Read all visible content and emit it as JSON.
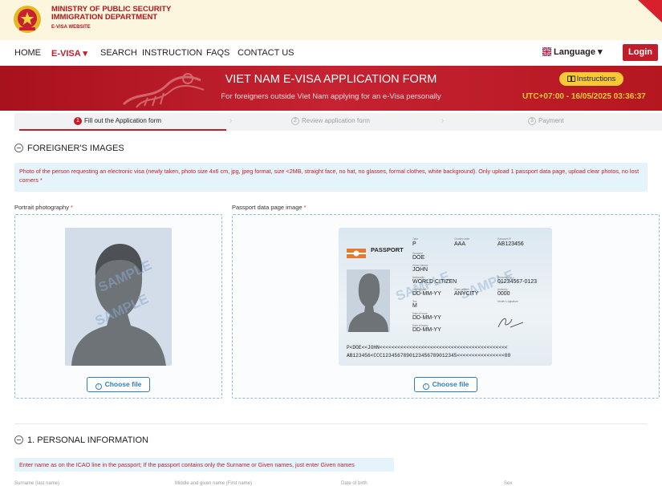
{
  "header": {
    "ministry_line1": "MINISTRY OF PUBLIC SECURITY",
    "ministry_line2": "IMMIGRATION DEPARTMENT",
    "ministry_line3": "E-VISA WEBSITE",
    "emblem_icon": "national-emblem-icon"
  },
  "nav": {
    "home": "HOME",
    "evisa": "E-VISA ▾",
    "search": "SEARCH",
    "instruction": "INSTRUCTION",
    "faqs": "FAQS",
    "contact": "CONTACT US",
    "language": "Language ▾",
    "login": "Login"
  },
  "banner": {
    "title": "VIET NAM E-VISA APPLICATION FORM",
    "subtitle": "For foreigners outside Viet Nam applying for an e-Visa personally",
    "instructions": "Instructions",
    "clock": "UTC+07:00 - 16/05/2025 03:36:37"
  },
  "steps": [
    {
      "num": "1",
      "label": "Fill out the Application form"
    },
    {
      "num": "2",
      "label": "Review application form"
    },
    {
      "num": "3",
      "label": "Payment"
    }
  ],
  "images_section": {
    "title": "FOREIGNER'S IMAGES",
    "info": "Photo of the person requesting an electronic visa (newly taken, photo size 4x6 cm, jpg, jpeg format, size <2MB, straight face, no hat, no glasses, formal clothes, white background). Only upload 1 passport data page, upload clear photos, no lost corners",
    "portrait_label": "Portrait photography",
    "passport_label": "Passport data page image",
    "choose_file": "Choose file",
    "sample_watermark": "SAMPLE"
  },
  "passport_sample": {
    "passport_word": "PASSPORT",
    "type_label": "Type",
    "type_value": "P",
    "country_label": "Country code",
    "country_value": "AAA",
    "number_label": "Passport Nº",
    "number_value": "AB123456",
    "surname_label": "Surname",
    "surname_value": "DOE",
    "given_label": "Given Names",
    "given_value": "JOHN",
    "nationality_label": "Nationality",
    "nationality_value": "WORLD CITIZEN",
    "dob_label": "Date of birth",
    "dob_value": "DD-MM-YY",
    "pob_label": "Place of birth",
    "pob_value": "ANYCITY",
    "personal_label": "Personal No.",
    "personal_value": "01234567-0123",
    "authority_label": "Authority",
    "authority_value": "0000",
    "sex_label": "Sex",
    "sex_value": "M",
    "signature_label": "Holder's signature",
    "issue_label": "Date of issue",
    "issue_value": "DD-MM-YY",
    "expiry_label": "Date of expiry",
    "expiry_value": "DD-MM-YY",
    "mrz1": "P<DOE<<JOHN<<<<<<<<<<<<<<<<<<<<<<<<<<<<<<<<<<<<<<<<<<<",
    "mrz2": "AB123456<CCC1234567890123456789012345<<<<<<<<<<<<<<<<00"
  },
  "personal_section": {
    "title": "1. PERSONAL INFORMATION",
    "info": "Enter name as on the ICAO line in the passport; If the passport contains only the Surname or Given names, just enter Given names",
    "surname_label": "Surname (last name)",
    "middle_label": "Middle and given name (First name)",
    "dob_label": "Date of birth",
    "sex_label": "Sex"
  },
  "colors": {
    "brand_red": "#c01e2b",
    "accent_yellow": "#f7c936",
    "info_bg": "#e4f4fa"
  }
}
